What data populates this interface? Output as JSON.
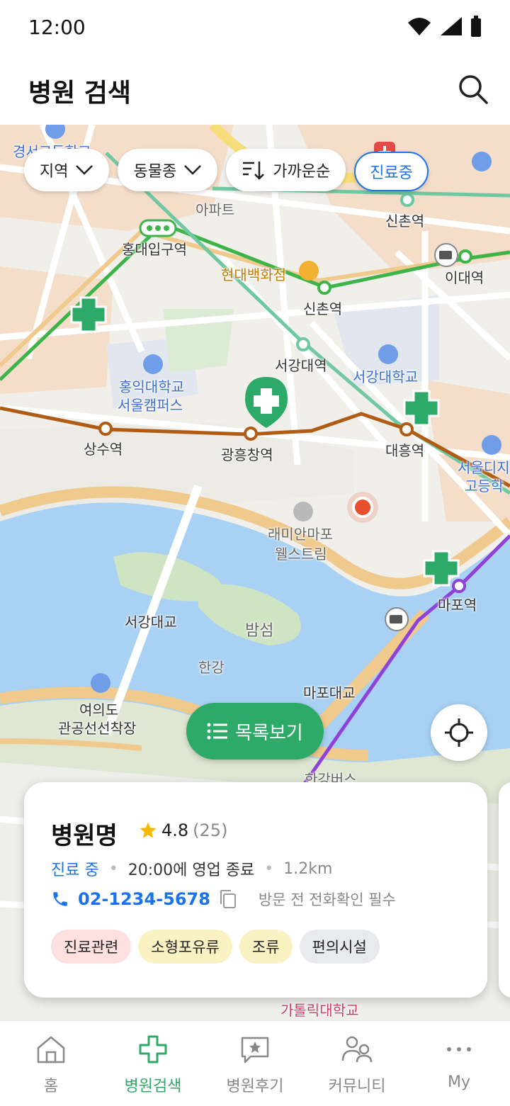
{
  "status_bar": {
    "time": "12:00"
  },
  "header": {
    "title": "병원 검색"
  },
  "filters": {
    "region": "지역",
    "species": "동물종",
    "sort": "가까운순",
    "open_now": "진료중"
  },
  "map_labels": [
    {
      "text": "경서고등학교",
      "cls": "blue"
    },
    {
      "text": "아파트",
      "cls": "gray"
    },
    {
      "text": "신촌역",
      "cls": ""
    },
    {
      "text": "홍대입구역",
      "cls": ""
    },
    {
      "text": "현대백화점",
      "cls": "orange"
    },
    {
      "text": "이대역",
      "cls": ""
    },
    {
      "text": "신촌역",
      "cls": ""
    },
    {
      "text": "서강대역",
      "cls": ""
    },
    {
      "text": "서강대학교",
      "cls": "blue"
    },
    {
      "text": "홍익대학교",
      "cls": "blue"
    },
    {
      "text": "서울캠퍼스",
      "cls": "blue"
    },
    {
      "text": "상수역",
      "cls": ""
    },
    {
      "text": "광흥창역",
      "cls": ""
    },
    {
      "text": "대흥역",
      "cls": ""
    },
    {
      "text": "서울디지",
      "cls": "blue"
    },
    {
      "text": "고등학",
      "cls": "blue"
    },
    {
      "text": "래미안마포",
      "cls": "gray"
    },
    {
      "text": "웰스트림",
      "cls": "gray"
    },
    {
      "text": "마포역",
      "cls": ""
    },
    {
      "text": "서강대교",
      "cls": ""
    },
    {
      "text": "밤섬",
      "cls": "gray"
    },
    {
      "text": "한강",
      "cls": "gray"
    },
    {
      "text": "마포대교",
      "cls": ""
    },
    {
      "text": "여의도",
      "cls": ""
    },
    {
      "text": "관공선선착장",
      "cls": ""
    },
    {
      "text": "한강버스",
      "cls": "gray"
    },
    {
      "text": "가톨릭대학교",
      "cls": "pink"
    }
  ],
  "list_button": {
    "label": "목록보기"
  },
  "hospital_card": {
    "name": "병원명",
    "rating": "4.8",
    "review_count": "(25)",
    "status": "진료 중",
    "close_time": "20:00에 영업 종료",
    "distance": "1.2km",
    "phone": "02-1234-5678",
    "note": "방문 전 전화확인 필수",
    "tags": [
      {
        "label": "진료관련",
        "color": "#fde0df"
      },
      {
        "label": "소형포유류",
        "color": "#fbf2c4"
      },
      {
        "label": "조류",
        "color": "#fbf2c4"
      },
      {
        "label": "편의시설",
        "color": "#e8eaed"
      }
    ]
  },
  "bottom_nav": {
    "items": [
      {
        "label": "홈",
        "icon": "home-icon"
      },
      {
        "label": "병원검색",
        "icon": "hospital-cross-icon"
      },
      {
        "label": "병원후기",
        "icon": "review-icon"
      },
      {
        "label": "커뮤니티",
        "icon": "community-icon"
      },
      {
        "label": "My",
        "icon": "more-icon"
      }
    ]
  },
  "colors": {
    "primary_green": "#2daa67",
    "accent_blue": "#1a73e8",
    "live_status_blue": "#1a73e8",
    "river": "#a8d1f3",
    "current_location": "#e8502d"
  }
}
